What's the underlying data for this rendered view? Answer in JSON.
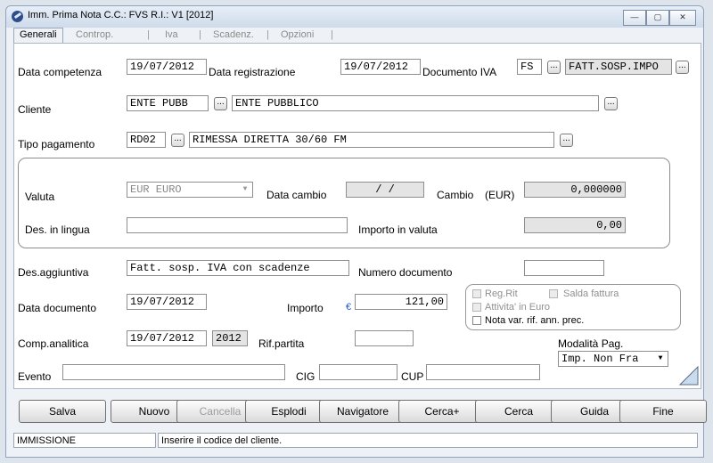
{
  "window": {
    "title": "Imm. Prima Nota C.C.: FVS R.I.: V1 [2012]",
    "controls": {
      "minimize": "—",
      "maximize": "▢",
      "close": "✕"
    }
  },
  "tabs": [
    "Generali",
    "Controp.",
    "Iva",
    "Scadenz.",
    "Opzioni"
  ],
  "form": {
    "data_competenza": {
      "label": "Data competenza",
      "value": "19/07/2012"
    },
    "data_registrazione": {
      "label": "Data registrazione",
      "value": "19/07/2012"
    },
    "documento_iva": {
      "label": "Documento IVA",
      "code": "FS",
      "desc": "FATT.SOSP.IMPO"
    },
    "cliente": {
      "label": "Cliente",
      "code": "ENTE PUBB",
      "desc": "ENTE PUBBLICO"
    },
    "tipo_pagamento": {
      "label": "Tipo pagamento",
      "code": "RD02",
      "desc": "RIMESSA DIRETTA 30/60 FM"
    },
    "valuta": {
      "label": "Valuta",
      "value": "EUR EURO"
    },
    "data_cambio": {
      "label": "Data cambio",
      "value": " /  / "
    },
    "cambio": {
      "label": "Cambio",
      "unit": "(EUR)",
      "value": "0,000000"
    },
    "des_lingua": {
      "label": "Des. in lingua",
      "value": ""
    },
    "importo_valuta": {
      "label": "Importo in valuta",
      "value": "0,00"
    },
    "des_aggiuntiva": {
      "label": "Des.aggiuntiva",
      "value": "Fatt. sosp. IVA con scadenze"
    },
    "numero_documento": {
      "label": "Numero documento",
      "value": ""
    },
    "data_documento": {
      "label": "Data documento",
      "value": "19/07/2012"
    },
    "importo": {
      "label": "Importo",
      "currency": "€",
      "value": "121,00"
    },
    "comp_analitica": {
      "label": "Comp.analitica",
      "value": "19/07/2012",
      "year": "2012"
    },
    "rif_partita": {
      "label": "Rif.partita",
      "value": ""
    },
    "modalita_pag": {
      "label": "Modalità Pag.",
      "value": "Imp. Non Fra"
    },
    "evento": {
      "label": "Evento",
      "value": ""
    },
    "cig": {
      "label": "CIG",
      "value": ""
    },
    "cup": {
      "label": "CUP",
      "value": ""
    },
    "checks": {
      "reg_rit": "Reg.Rit",
      "salda_fattura": "Salda fattura",
      "attivita_euro": "Attivita' in Euro",
      "nota_var": "Nota var. rif. ann. prec."
    }
  },
  "buttons": [
    "Salva",
    "Nuovo",
    "Cancella",
    "Esplodi",
    "Navigatore",
    "Cerca+",
    "Cerca",
    "Guida",
    "Fine"
  ],
  "status": {
    "mode": "IMMISSIONE",
    "message": "Inserire il codice del cliente."
  }
}
